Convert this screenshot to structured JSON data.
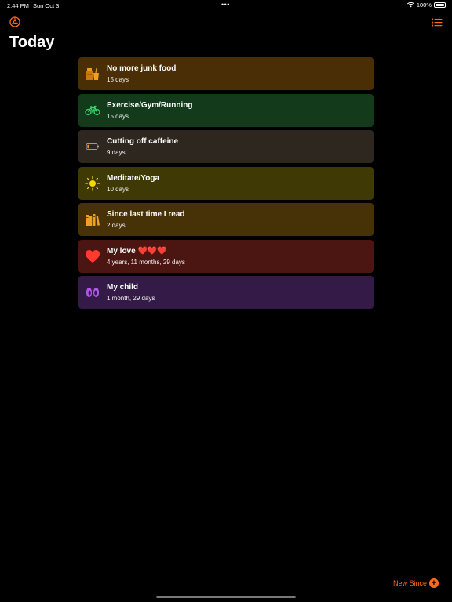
{
  "status_bar": {
    "time": "2:44 PM",
    "date": "Sun Oct 3",
    "dots": "•••",
    "battery": "100%",
    "battery_level": 1.0
  },
  "header": {
    "title": "Today",
    "settings_icon": "gear-circle-icon",
    "list_icon": "list-icon"
  },
  "accent_color": "#ff6a1a",
  "items": [
    {
      "title": "No more junk food",
      "subtitle": "15 days",
      "icon": "junk-food-icon",
      "color": "#4a2e05"
    },
    {
      "title": "Exercise/Gym/Running",
      "subtitle": "15 days",
      "icon": "bicycle-icon",
      "color": "#123a1b"
    },
    {
      "title": "Cutting off caffeine",
      "subtitle": "9 days",
      "icon": "low-battery-icon",
      "color": "#2e2720"
    },
    {
      "title": "Meditate/Yoga",
      "subtitle": "10 days",
      "icon": "sun-icon",
      "color": "#3f3a05"
    },
    {
      "title": "Since last time I read",
      "subtitle": "2 days",
      "icon": "books-icon",
      "color": "#473107"
    },
    {
      "title": "My love ❤️❤️❤️",
      "subtitle": "4 years, 11 months, 29 days",
      "icon": "heart-icon",
      "color": "#4b1612"
    },
    {
      "title": "My child",
      "subtitle": "1 month, 29 days",
      "icon": "footprints-icon",
      "color": "#341b47"
    }
  ],
  "footer": {
    "new_since_label": "New Since"
  }
}
